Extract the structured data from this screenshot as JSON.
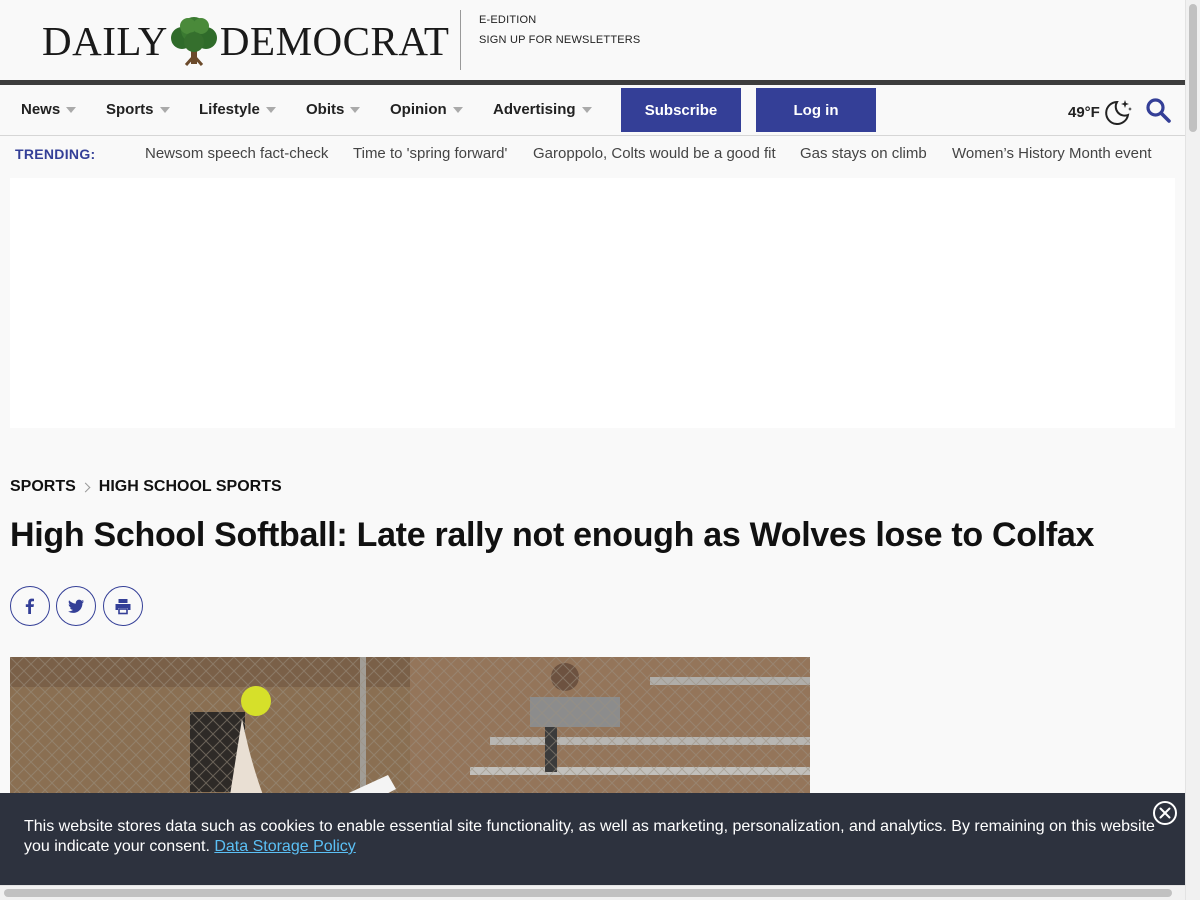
{
  "masthead": {
    "logo_left": "DAILY",
    "logo_right": "DEMOCRAT",
    "links": [
      "E-EDITION",
      "SIGN UP FOR NEWSLETTERS"
    ]
  },
  "nav": {
    "items": [
      "News",
      "Sports",
      "Lifestyle",
      "Obits",
      "Opinion",
      "Advertising"
    ],
    "subscribe": "Subscribe",
    "login": "Log in",
    "weather": "49°F"
  },
  "trending": {
    "label": "TRENDING:",
    "items": [
      "Newsom speech fact-check",
      "Time to 'spring forward'",
      "Garoppolo, Colts would be a good fit",
      "Gas stays on climb",
      "Women’s History Month event"
    ]
  },
  "article": {
    "breadcrumb": [
      "SPORTS",
      "HIGH SCHOOL SPORTS"
    ],
    "headline": "High School Softball: Late rally not enough as Wolves lose to Colfax"
  },
  "cookie_banner": {
    "text": "This website stores data such as cookies to enable essential site functionality, as well as marketing, personalization, and analytics. By remaining on this website you indicate your consent.",
    "link": "Data Storage Policy"
  },
  "colors": {
    "brand": "#343f97",
    "banner_bg": "#2d323e",
    "link": "#5bc0f5"
  }
}
